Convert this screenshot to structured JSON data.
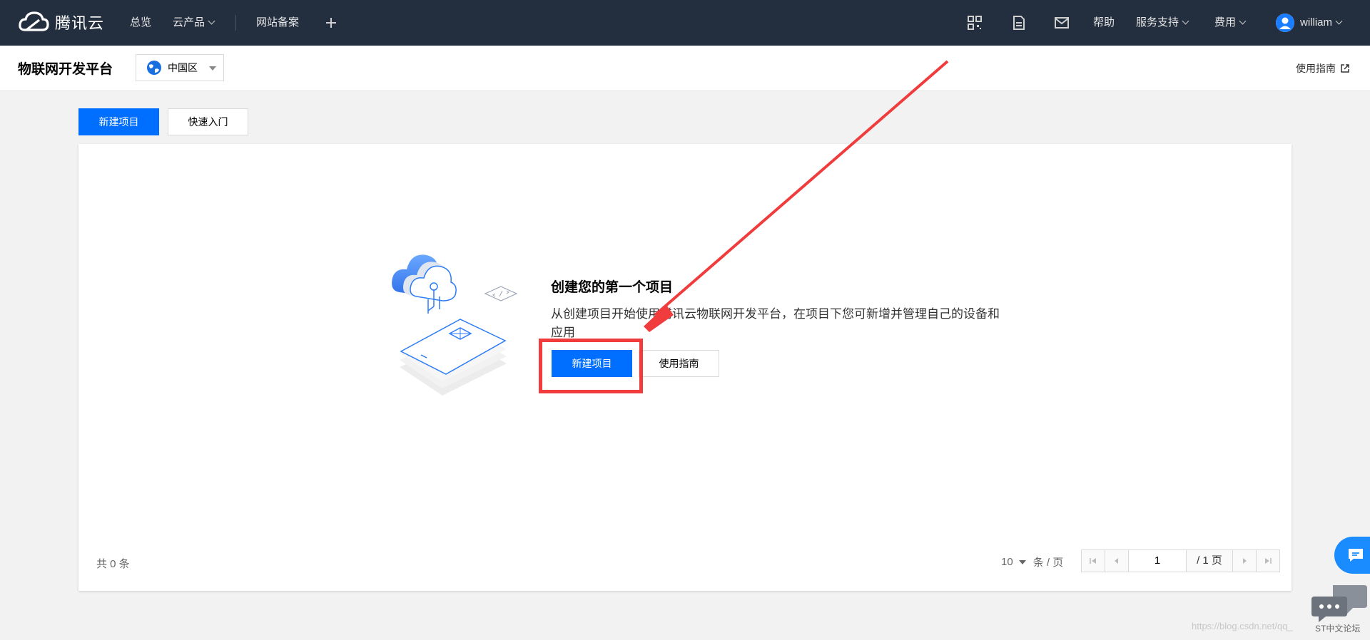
{
  "topnav": {
    "brand": "腾讯云",
    "items": [
      "总览",
      "云产品",
      "网站备案"
    ],
    "right_items": [
      "帮助",
      "服务支持",
      "费用"
    ],
    "user": "william"
  },
  "subheader": {
    "title": "物联网开发平台",
    "region": "中国区",
    "guide": "使用指南"
  },
  "actions": {
    "new_project": "新建项目",
    "quick_start": "快速入门"
  },
  "empty_state": {
    "title": "创建您的第一个项目",
    "description": "从创建项目开始使用腾讯云物联网开发平台，在项目下您可新增并管理自己的设备和应用",
    "primary_button": "新建项目",
    "secondary_button": "使用指南"
  },
  "pagination": {
    "total": "共 0 条",
    "page_size": "10",
    "page_size_unit": "条 / 页",
    "current_page": "1",
    "total_pages": "/ 1 页"
  },
  "watermark": "https://blog.csdn.net/qq_",
  "forum_label": "ST中文论坛",
  "colors": {
    "nav_bg": "#232e3e",
    "primary": "#006eff",
    "highlight": "#f03c3c",
    "page_bg": "#f2f2f2"
  }
}
